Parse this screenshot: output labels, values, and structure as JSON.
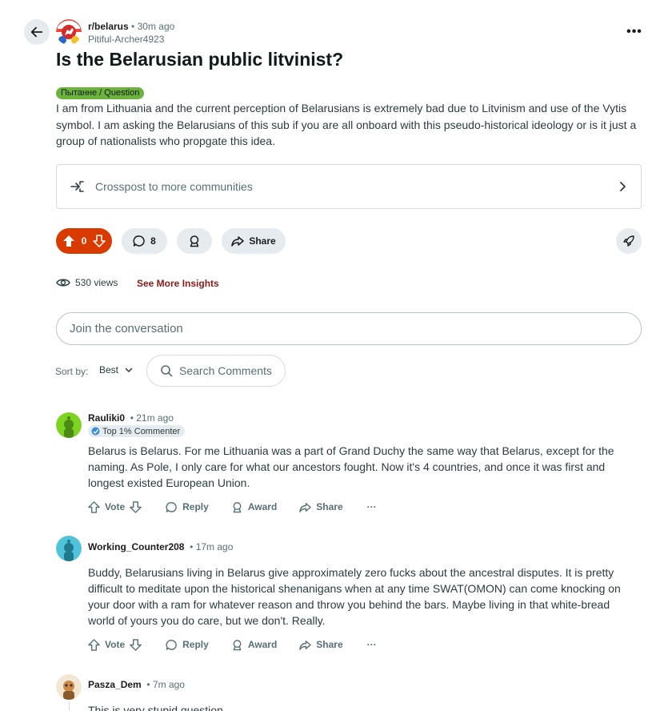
{
  "post": {
    "subreddit": "r/belarus",
    "time": "30m ago",
    "author": "Pitiful-Archer4923",
    "title": "Is the Belarusian public litvinist?",
    "flair": "Пытанне / Question",
    "body": "I am from Lithuania and the current perception of Belarusians is extremely bad due to Litvinism and use of the Vytis symbol. I am asking the Belarusians of this sub if you are all onboard with this pseudo-historical ideology or is it just a group of nationalists who propgate this idea.",
    "more_label": "•••",
    "flair_color": "#6bb33a"
  },
  "crosspost": {
    "label": "Crosspost to more communities"
  },
  "actions": {
    "votes": "0",
    "comments": "8",
    "share": "Share",
    "vote_color": "#d93a00"
  },
  "insights": {
    "views": "530 views",
    "link": "See More Insights"
  },
  "join": {
    "placeholder": "Join the conversation"
  },
  "sort": {
    "label": "Sort by:",
    "value": "Best",
    "search_placeholder": "Search Comments"
  },
  "comments": [
    {
      "username": "Rauliki0",
      "time": "21m ago",
      "badge": "Top 1% Commenter",
      "text": "Belarus is Belarus. For me Lithuania was a part of Grand Duchy the same way that Belarus, except for the naming. As Pole, I only care for what our ancestors fought. Now it's 4 countries, and once it was first and longest existed European Union.",
      "vote": "Vote",
      "reply": "Reply",
      "award": "Award",
      "share": "Share",
      "more": "···"
    },
    {
      "username": "Working_Counter208",
      "time": "17m ago",
      "text": "Buddy, Belarusians living in Belarus give approximately zero fucks about the ancestral disputes. It is pretty difficult to meditate upon the historical shenanigans when at any time SWAT(OMON) can come knocking on your door with a ram for whatever reason and throw you behind the bars. Maybe living in that white-bread world of yours you do care, but we don't. Really.",
      "vote": "Vote",
      "reply": "Reply",
      "award": "Award",
      "share": "Share",
      "more": "···"
    },
    {
      "username": "Pasza_Dem",
      "time": "7m ago",
      "text": "This is very stupid question."
    }
  ],
  "separator": "•"
}
